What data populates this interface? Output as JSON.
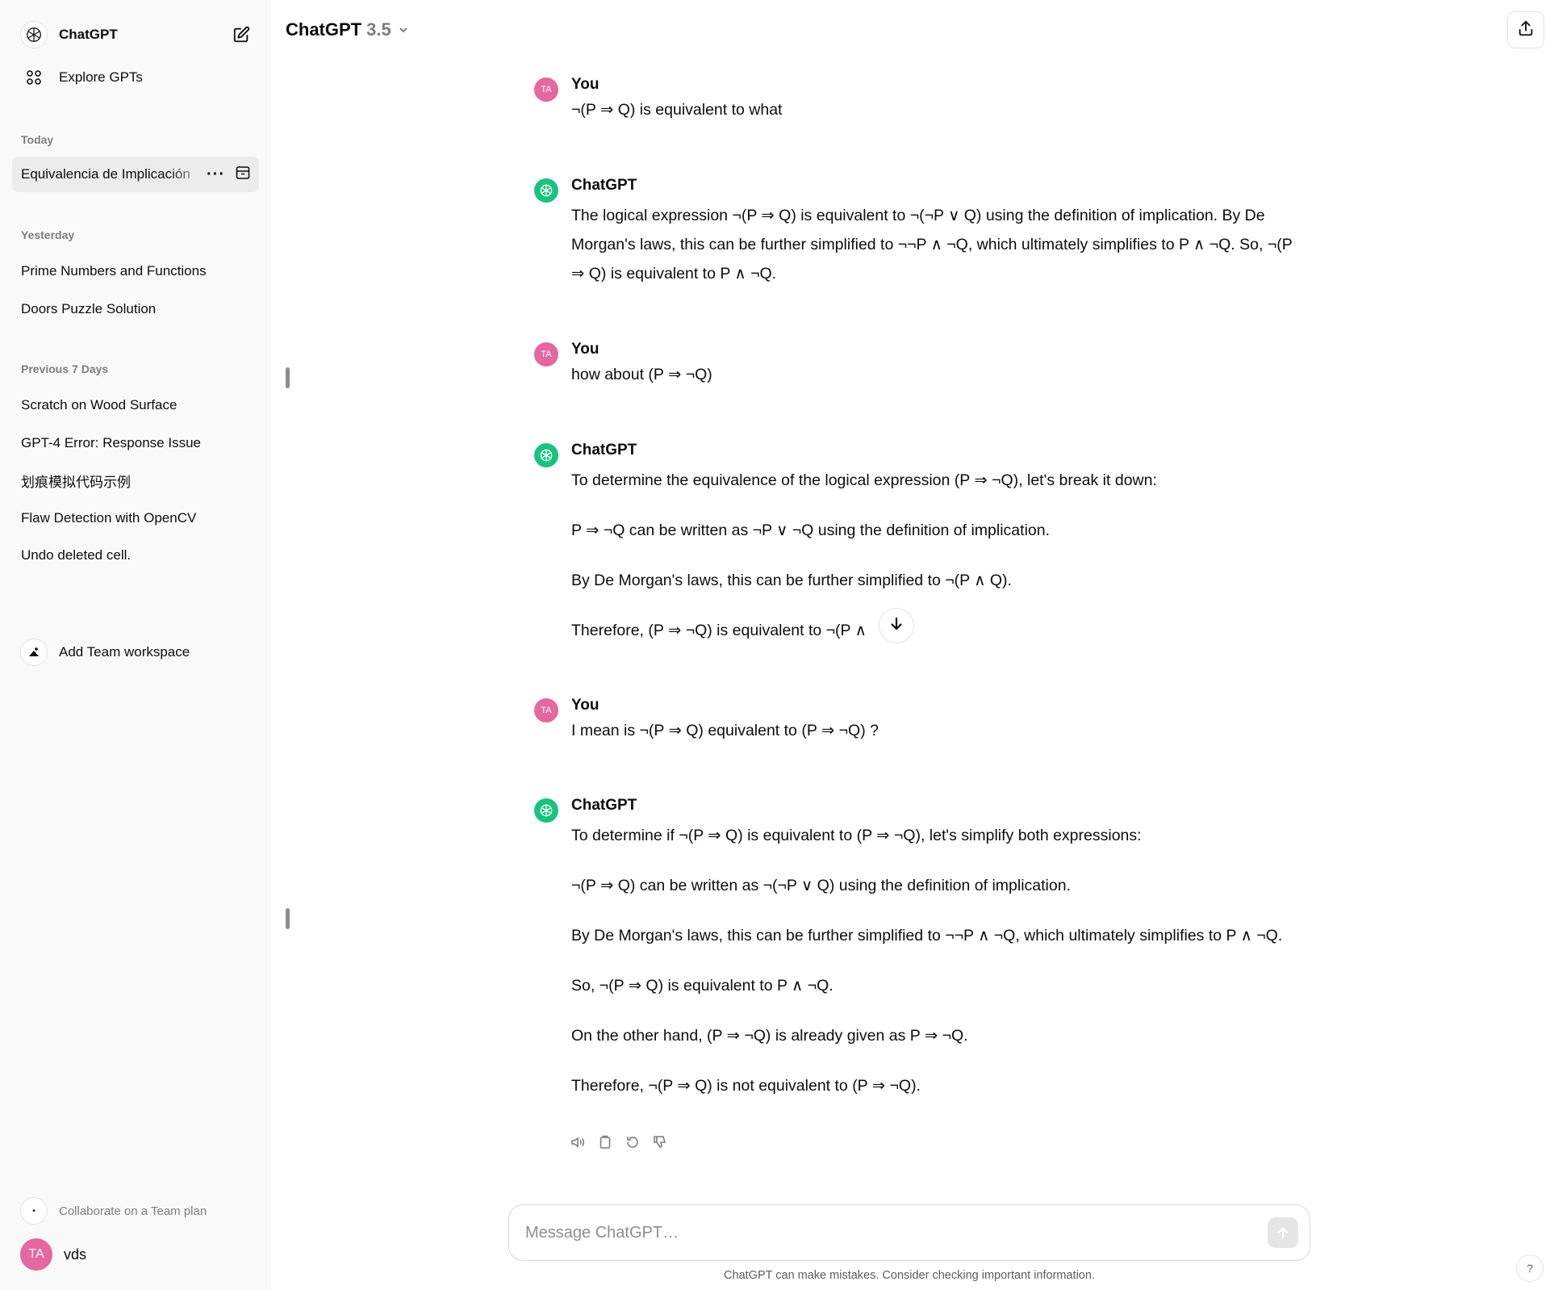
{
  "sidebar": {
    "app_label": "ChatGPT",
    "explore_label": "Explore GPTs",
    "sections": [
      {
        "label": "Today",
        "items": [
          "Equivalencia de Implicación"
        ]
      },
      {
        "label": "Yesterday",
        "items": [
          "Prime Numbers and Functions",
          "Doors Puzzle Solution"
        ]
      },
      {
        "label": "Previous 7 Days",
        "items": [
          "Scratch on Wood Surface",
          "GPT-4 Error: Response Issue",
          "划痕模拟代码示例",
          "Flaw Detection with OpenCV",
          "Undo deleted cell."
        ]
      }
    ],
    "team_label": "Add Team workspace",
    "collab_label": "Collaborate on a Team plan",
    "user": {
      "initials": "TA",
      "name": "vds"
    }
  },
  "header": {
    "model_name": "ChatGPT",
    "model_version": "3.5"
  },
  "conversation": [
    {
      "author": "You",
      "avatar": "TA",
      "paragraphs": [
        "¬(P ⇒ Q) is equivalent to what"
      ]
    },
    {
      "author": "ChatGPT",
      "paragraphs": [
        "The logical expression ¬(P ⇒ Q) is equivalent to ¬(¬P ∨ Q) using the definition of implication. By De Morgan's laws, this can be further simplified to ¬¬P ∧ ¬Q, which ultimately simplifies to P ∧ ¬Q. So, ¬(P ⇒ Q) is equivalent to P ∧ ¬Q."
      ]
    },
    {
      "author": "You",
      "avatar": "TA",
      "paragraphs": [
        "how about (P ⇒ ¬Q)"
      ]
    },
    {
      "author": "ChatGPT",
      "paragraphs": [
        "To determine the equivalence of the logical expression (P ⇒ ¬Q), let's break it down:",
        "P ⇒ ¬Q can be written as ¬P ∨ ¬Q using the definition of implication.",
        "By De Morgan's laws, this can be further simplified to ¬(P ∧ Q).",
        "Therefore, (P ⇒ ¬Q) is equivalent to ¬(P ∧"
      ]
    },
    {
      "author": "You",
      "avatar": "TA",
      "paragraphs": [
        "I mean is ¬(P ⇒ Q)  equivalent to (P ⇒ ¬Q) ?"
      ]
    },
    {
      "author": "ChatGPT",
      "paragraphs": [
        "To determine if ¬(P ⇒ Q) is equivalent to (P ⇒ ¬Q), let's simplify both expressions:",
        "¬(P ⇒ Q) can be written as ¬(¬P ∨ Q) using the definition of implication.",
        "By De Morgan's laws, this can be further simplified to ¬¬P ∧ ¬Q, which ultimately simplifies to P ∧ ¬Q.",
        "So, ¬(P ⇒ Q) is equivalent to P ∧ ¬Q.",
        "On the other hand, (P ⇒ ¬Q) is already given as P ⇒ ¬Q.",
        "Therefore, ¬(P ⇒ Q) is not equivalent to (P ⇒ ¬Q)."
      ]
    }
  ],
  "composer": {
    "placeholder": "Message ChatGPT…"
  },
  "disclaimer": "ChatGPT can make mistakes. Consider checking important information.",
  "help_label": "?",
  "icons": {
    "logo": "openai-logo-icon",
    "new_chat": "edit-icon",
    "explore": "grid-icon",
    "share": "share-icon",
    "scroll_down": "arrow-down-icon",
    "send": "arrow-up-icon",
    "read_aloud": "speaker-icon",
    "copy": "clipboard-icon",
    "regenerate": "refresh-icon",
    "dislike": "thumbs-down-icon"
  },
  "colors": {
    "user_avatar": "#e5679f",
    "bot_avatar": "#19c37d",
    "sidebar_bg": "#f9f9f9",
    "active_item": "#ececec"
  }
}
